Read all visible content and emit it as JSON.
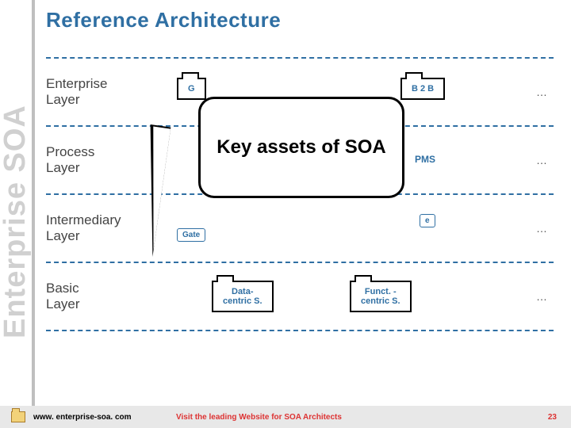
{
  "header": {
    "title": "Reference Architecture"
  },
  "side_title": "Enterprise SOA",
  "callout": {
    "text": "Key assets of SOA"
  },
  "rows": {
    "enterprise": {
      "label": "Enterprise\nLayer",
      "box_left_peek": "G",
      "box_right": "B 2 B",
      "dots": "…"
    },
    "process": {
      "label": "Process\nLayer",
      "pms_peek": "PMS",
      "dots": "…"
    },
    "intermediary": {
      "label": "Intermediary\nLayer",
      "gate_peek": "Gate",
      "right_peek": "e",
      "dots": "…"
    },
    "basic": {
      "label": "Basic\nLayer",
      "folder_left": "Data-\ncentric S.",
      "folder_right": "Funct. -\ncentric S.",
      "dots": "…"
    }
  },
  "footer": {
    "url": "www. enterprise-soa. com",
    "cta": "Visit the leading Website for SOA Architects",
    "page": "23"
  }
}
